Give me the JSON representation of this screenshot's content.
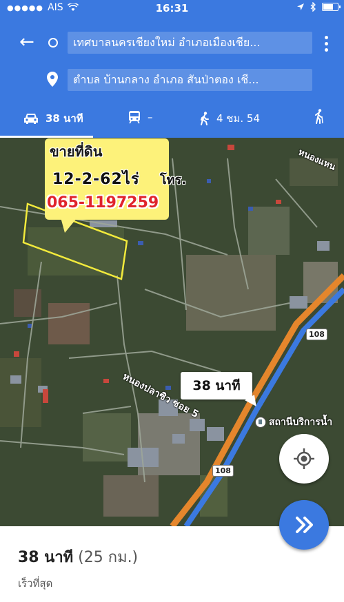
{
  "status_bar": {
    "carrier": "AIS",
    "time": "16:31",
    "battery_level": 0.8
  },
  "route": {
    "origin": "เทศบาลนครเชียงใหม่ อำเภอเมืองเชีย...",
    "destination": "ตำบล บ้านกลาง อำเภอ สันป่าตอง เชี...",
    "back_icon": "back-arrow-icon",
    "menu_icon": "more-vert-icon"
  },
  "modes": {
    "drive": {
      "icon": "car-icon",
      "label": "38 นาที"
    },
    "transit": {
      "icon": "train-icon",
      "label": "–"
    },
    "walk": {
      "icon": "walk-icon",
      "label": "4 ชม. 54"
    },
    "other": {
      "icon": "person-icon"
    }
  },
  "map": {
    "ad": {
      "line1": "ขายที่ดิน",
      "line2": "12-2-62ไร่",
      "line2b": "โทร.",
      "phone": "065-1197259"
    },
    "labels": {
      "top_right": "หนองแหน",
      "soi": "หนองปลาซิว ซอย 5",
      "poi": "สถานีบริการน้ำ"
    },
    "route_shields": [
      "108",
      "108"
    ],
    "time_callout": "38 นาที",
    "colors": {
      "route": "#3b79e0",
      "highway": "#e5862c",
      "plot_outline": "#f2ea3c"
    }
  },
  "bottom": {
    "duration": "38 นาที",
    "distance": "(25 กม.)",
    "note": "เร็วที่สุด"
  }
}
